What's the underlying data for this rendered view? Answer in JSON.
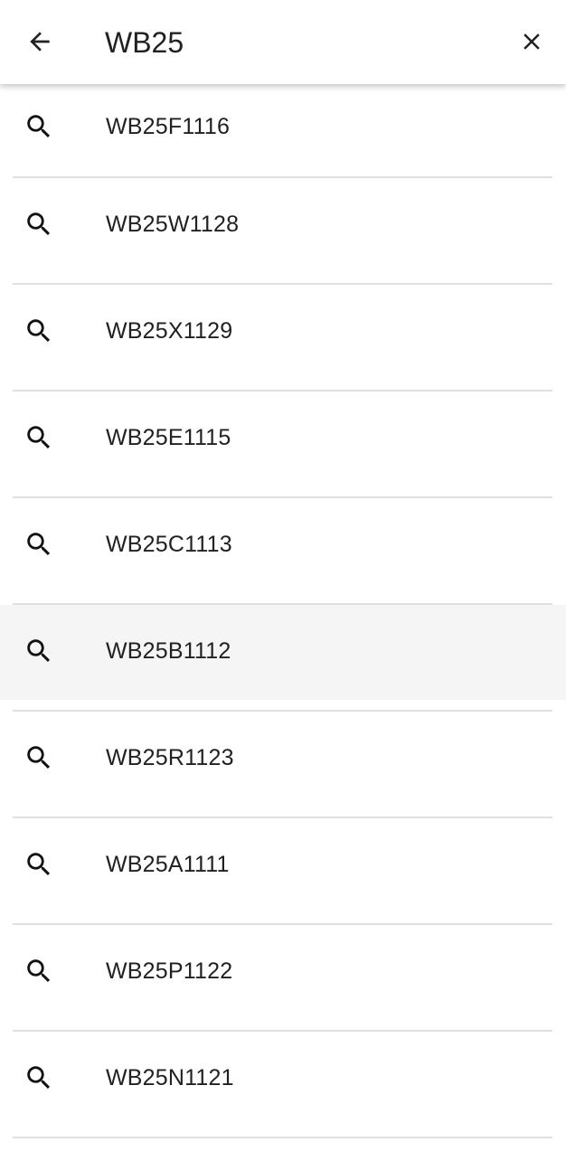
{
  "search": {
    "query": "WB25",
    "back_icon": "arrow-left-icon",
    "clear_icon": "close-icon"
  },
  "suggestions": [
    {
      "label": "WB25F1116",
      "icon": "search-icon",
      "highlighted": false
    },
    {
      "label": "WB25W1128",
      "icon": "search-icon",
      "highlighted": false
    },
    {
      "label": "WB25X1129",
      "icon": "search-icon",
      "highlighted": false
    },
    {
      "label": "WB25E1115",
      "icon": "search-icon",
      "highlighted": false
    },
    {
      "label": "WB25C1113",
      "icon": "search-icon",
      "highlighted": false
    },
    {
      "label": "WB25B1112",
      "icon": "search-icon",
      "highlighted": true
    },
    {
      "label": "WB25R1123",
      "icon": "search-icon",
      "highlighted": false
    },
    {
      "label": "WB25A1111",
      "icon": "search-icon",
      "highlighted": false
    },
    {
      "label": "WB25P1122",
      "icon": "search-icon",
      "highlighted": false
    },
    {
      "label": "WB25N1121",
      "icon": "search-icon",
      "highlighted": false
    }
  ],
  "colors": {
    "text": "#212121",
    "divider": "#e0e0e0",
    "highlight": "#f5f5f5",
    "background": "#ffffff"
  }
}
